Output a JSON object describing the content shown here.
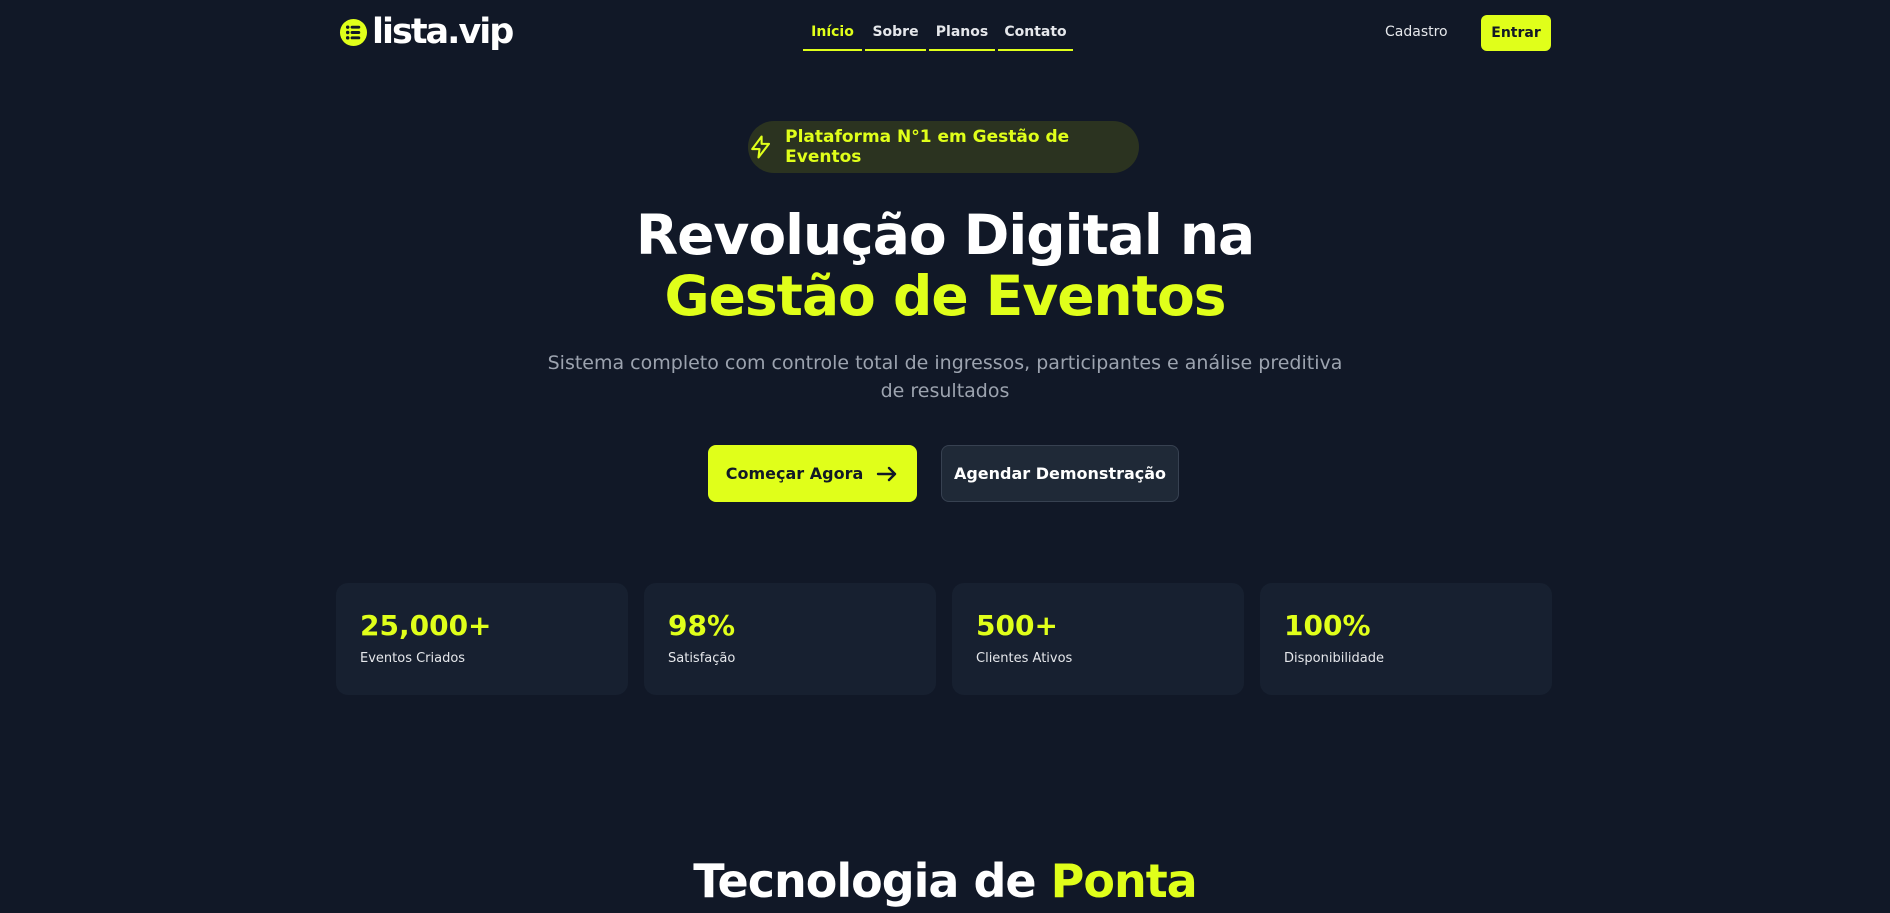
{
  "brand": {
    "name": "lista.vip",
    "accent": "#e0ff1a",
    "background": "#111827"
  },
  "nav": {
    "links": [
      {
        "label": "Início",
        "active": true
      },
      {
        "label": "Sobre",
        "active": false
      },
      {
        "label": "Planos",
        "active": false
      },
      {
        "label": "Contato",
        "active": false
      }
    ],
    "signup_label": "Cadastro",
    "login_label": "Entrar"
  },
  "hero": {
    "badge": {
      "icon": "lightning-icon",
      "text": "Plataforma N°1 em Gestão de Eventos"
    },
    "title_line1": "Revolução Digital na",
    "title_line2": "Gestão de Eventos",
    "subtitle": "Sistema completo com controle total de ingressos, participantes e análise preditiva de resultados",
    "primary_cta": {
      "label": "Começar Agora",
      "icon": "arrow-right-icon"
    },
    "secondary_cta": {
      "label": "Agendar Demonstração"
    }
  },
  "stats": [
    {
      "value": "25,000+",
      "label": "Eventos Criados"
    },
    {
      "value": "98%",
      "label": "Satisfação"
    },
    {
      "value": "500+",
      "label": "Clientes Ativos"
    },
    {
      "value": "100%",
      "label": "Disponibilidade"
    }
  ],
  "section": {
    "title_part1": "Tecnologia de",
    "title_part2": "Ponta"
  }
}
